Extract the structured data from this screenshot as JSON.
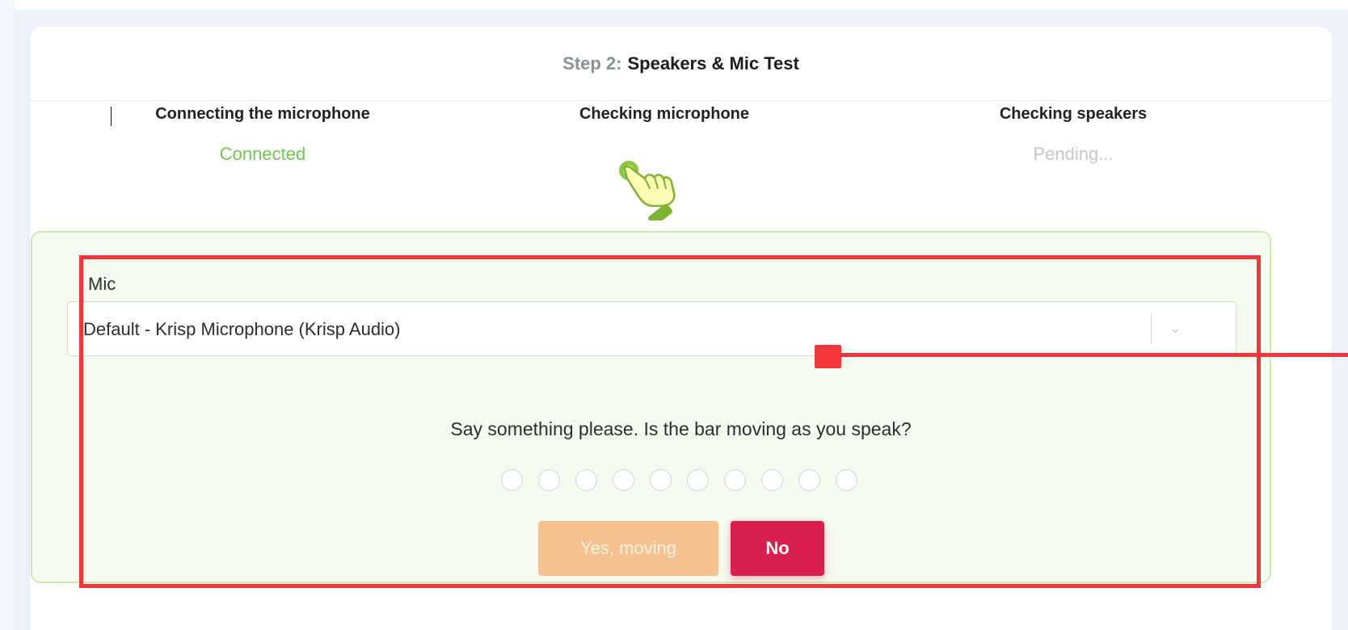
{
  "header": {
    "step_label": "Step 2:",
    "step_title": "Speakers & Mic Test"
  },
  "phases": [
    {
      "title": "Connecting the microphone",
      "status": "Connected"
    },
    {
      "title": "Checking microphone",
      "icon": "pointing-hand-icon"
    },
    {
      "title": "Checking speakers",
      "status": "Pending..."
    }
  ],
  "mic": {
    "label": "Mic",
    "selected": "Default - Krisp Microphone (Krisp Audio)"
  },
  "prompt": "Say something please. Is the bar moving as you speak?",
  "level_indicator": {
    "segments": 10,
    "active": 0
  },
  "buttons": {
    "yes": "Yes, moving",
    "no": "No"
  },
  "colors": {
    "connected": "#6cc94b",
    "pending": "#c3c6cc",
    "no_button": "#d91f4d",
    "yes_button": "#f5c28f",
    "panel_bg": "#f6fbef",
    "annotation": "#f0363a"
  }
}
